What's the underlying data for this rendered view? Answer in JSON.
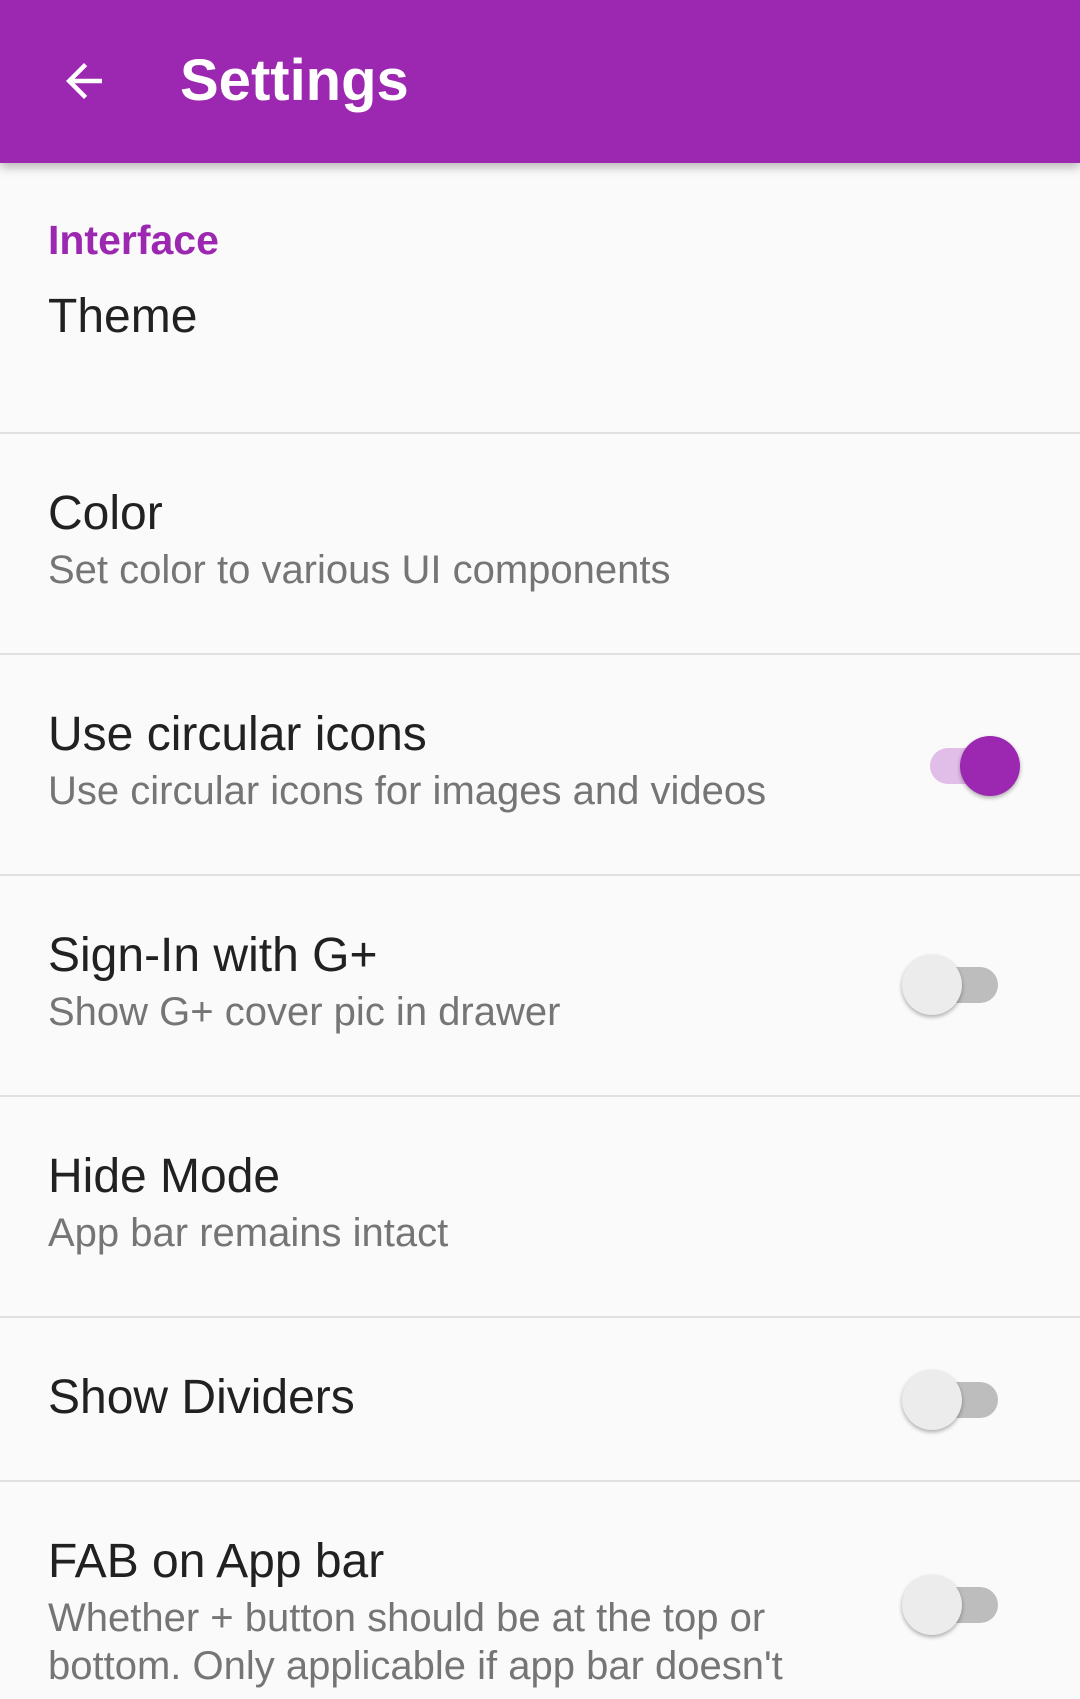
{
  "colors": {
    "primary": "#9c27b0",
    "background": "#fafafa",
    "title_text": "#212121",
    "summary_text": "#757575",
    "divider": "#e0e0e0"
  },
  "appbar": {
    "back_icon": "arrow-left-icon",
    "title": "Settings"
  },
  "section": {
    "header": "Interface"
  },
  "prefs": {
    "theme": {
      "title": "Theme"
    },
    "color": {
      "title": "Color",
      "summary": "Set color to various UI components"
    },
    "circular_icons": {
      "title": "Use circular icons",
      "summary": "Use circular icons for images and videos",
      "enabled": true
    },
    "sign_in": {
      "title": "Sign-In with G+",
      "summary": "Show G+ cover pic in drawer",
      "enabled": false
    },
    "hide_mode": {
      "title": "Hide Mode",
      "summary": "App bar remains intact"
    },
    "show_dividers": {
      "title": "Show Dividers",
      "enabled": false
    },
    "fab_on_appbar": {
      "title": "FAB on App bar",
      "summary": "Whether + button should be at the top or bottom. Only applicable if app bar doesn't",
      "enabled": false
    }
  }
}
